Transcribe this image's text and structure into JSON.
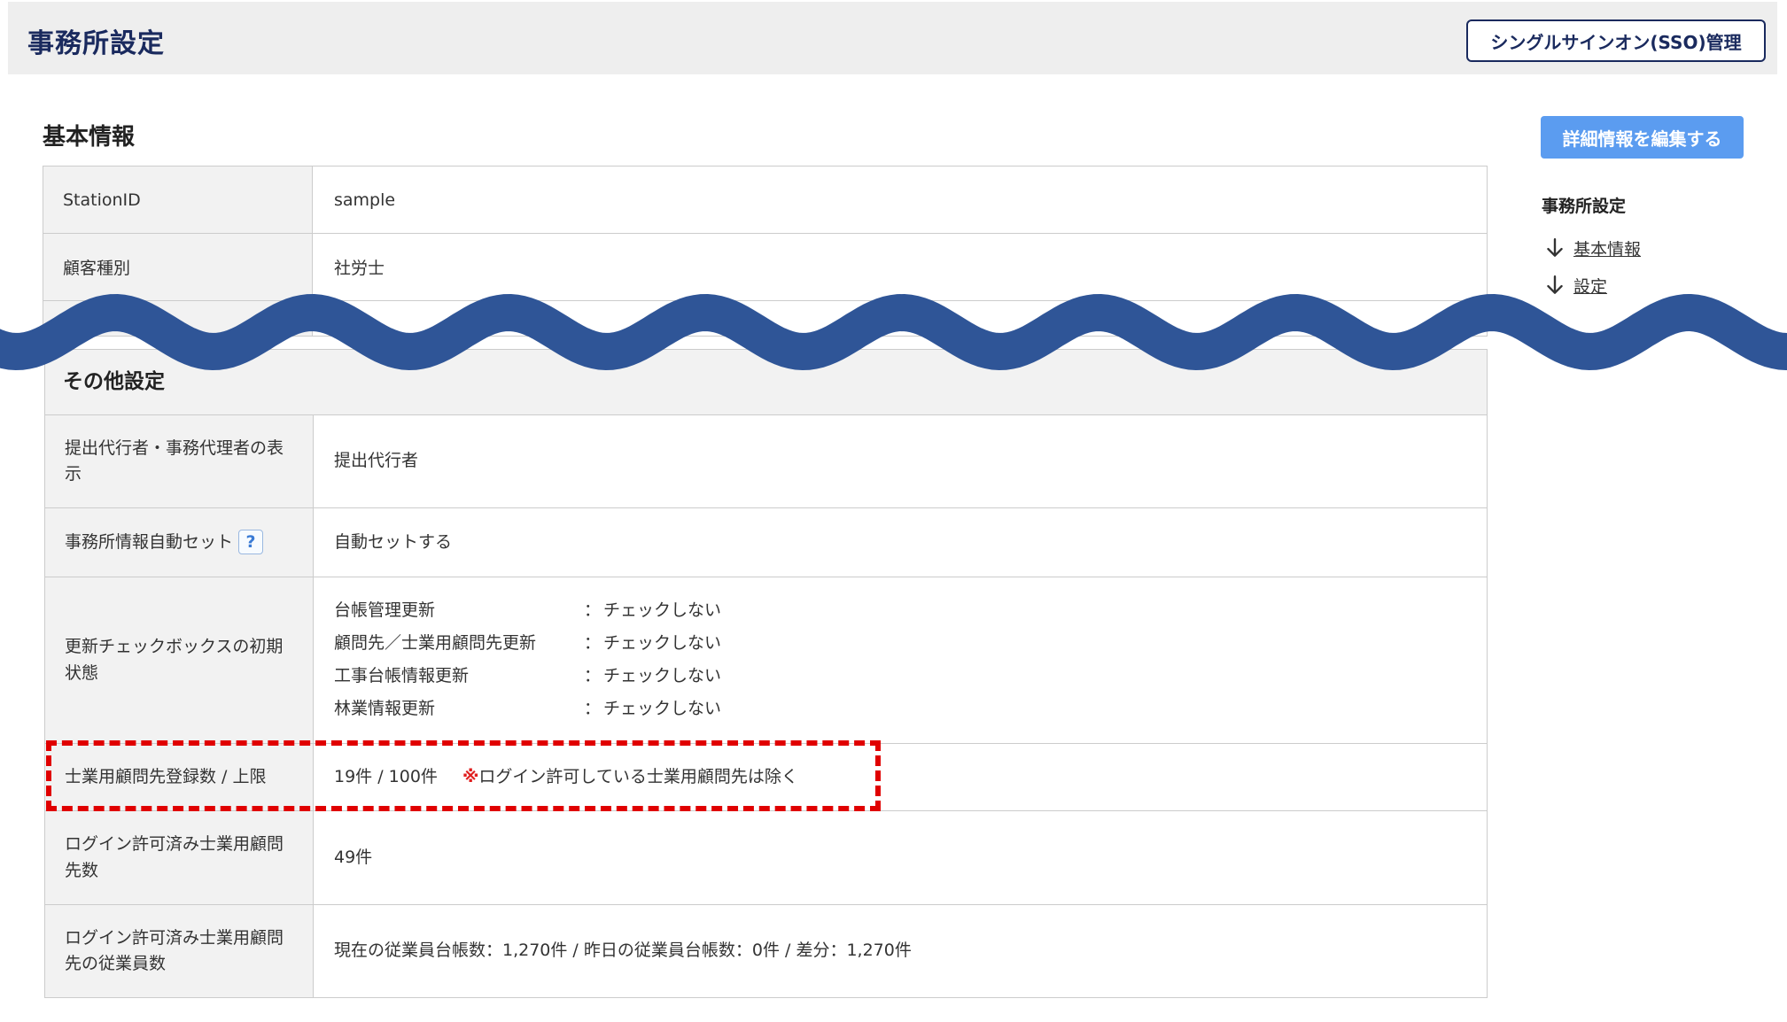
{
  "header": {
    "title": "事務所設定",
    "sso_button": "シングルサインオン(SSO)管理"
  },
  "basic": {
    "title": "基本情報",
    "edit_button": "詳細情報を編集する",
    "rows": [
      {
        "label": "StationID",
        "value": "sample"
      },
      {
        "label": "顧客種別",
        "value": "社労士"
      }
    ]
  },
  "side_nav": {
    "title": "事務所設定",
    "links": [
      "基本情報",
      "設定"
    ]
  },
  "other": {
    "title": "その他設定",
    "submit_label": "提出代行者・事務代理者の表示",
    "submit_value": "提出代行者",
    "auto_label": "事務所情報自動セット",
    "auto_help": "?",
    "auto_value": "自動セットする",
    "check_label": "更新チェックボックスの初期状態",
    "check_items": [
      {
        "name": "台帳管理更新",
        "sep": "：",
        "value": "チェックしない"
      },
      {
        "name": "顧問先／士業用顧問先更新",
        "sep": "：",
        "value": "チェックしない"
      },
      {
        "name": "工事台帳情報更新",
        "sep": "：",
        "value": "チェックしない"
      },
      {
        "name": "林業情報更新",
        "sep": "：",
        "value": "チェックしない"
      }
    ],
    "limit_label": "士業用顧問先登録数 / 上限",
    "limit_value": "19件 / 100件",
    "limit_note_mark": "※",
    "limit_note": "ログイン許可している士業用顧問先は除く",
    "login_label": "ログイン許可済み士業用顧問先数",
    "login_value": "49件",
    "emp_label": "ログイン許可済み士業用顧問先の従業員数",
    "emp_value": "現在の従業員台帳数：1,270件 / 昨日の従業員台帳数：0件 / 差分：1,270件"
  },
  "colors": {
    "title": "#1a2a5e",
    "edit_button": "#5b9cf0",
    "wave": "#2f5597",
    "highlight": "#e00000"
  }
}
